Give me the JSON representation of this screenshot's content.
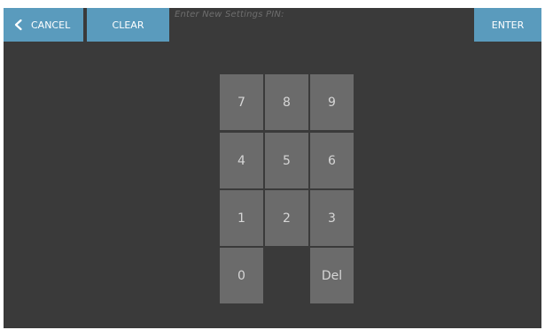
{
  "toolbar": {
    "cancel_label": "CANCEL",
    "clear_label": "CLEAR",
    "enter_label": "ENTER",
    "prompt": "Enter New Settings PIN:",
    "cancel_icon": "chevron-left-icon"
  },
  "keypad": {
    "keys": [
      "7",
      "8",
      "9",
      "4",
      "5",
      "6",
      "1",
      "2",
      "3",
      "0",
      "Del"
    ]
  },
  "colors": {
    "accent": "#5a9bbd",
    "background": "#3a3a3a",
    "key": "#6b6b6b",
    "key_text": "#d6d6d6",
    "prompt_text": "#6e6e6e"
  }
}
